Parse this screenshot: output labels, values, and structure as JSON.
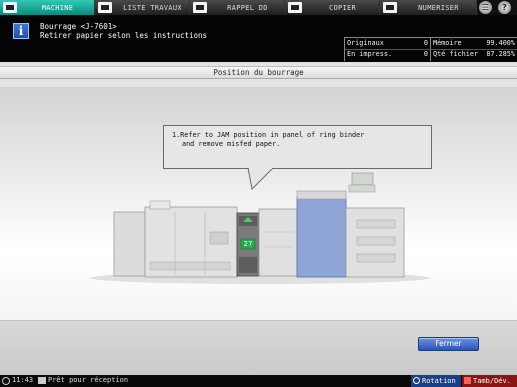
{
  "tabs": [
    {
      "label": "MACHINE",
      "icon": "machine-icon",
      "active": true
    },
    {
      "label": "LISTE TRAVAUX",
      "icon": "job-list-icon",
      "active": false
    },
    {
      "label": "RAPPEL DD",
      "icon": "hdd-recall-icon",
      "active": false
    },
    {
      "label": "COPIER",
      "icon": "copy-icon",
      "active": false
    },
    {
      "label": "NUMERISER",
      "icon": "scan-icon",
      "active": false
    }
  ],
  "top_buttons": {
    "utility_label": "☰",
    "help_label": "?"
  },
  "message": {
    "line1": "Bourrage  <J-7601>",
    "line2": "Retirer papier selon les instructions",
    "icon_glyph": "i"
  },
  "counters": {
    "originals_label": "Originaux",
    "originals_value": "0",
    "in_print_label": "En impress.",
    "in_print_value": "0",
    "memory_label": "Mémoire",
    "memory_value": "99.400%",
    "file_qty_label": "Qté fichier",
    "file_qty_value": "87.285%"
  },
  "panel": {
    "title": "Position du bourrage",
    "instruction_line1": "1.Refer to JAM position in panel of ring binder",
    "instruction_line2": "and remove misfed paper.",
    "jam_marker": "27",
    "close_label": "Fermer"
  },
  "status": {
    "time": "11:43",
    "text": "Prêt pour réception",
    "rotation_label": "Rotation",
    "tambdev_label": "Tamb/Dév."
  },
  "colors": {
    "active_tab": "#1aa898",
    "close_button": "#3a66c8",
    "jam_highlight": "#2aa84a",
    "selected_unit": "#8fa5d8"
  }
}
